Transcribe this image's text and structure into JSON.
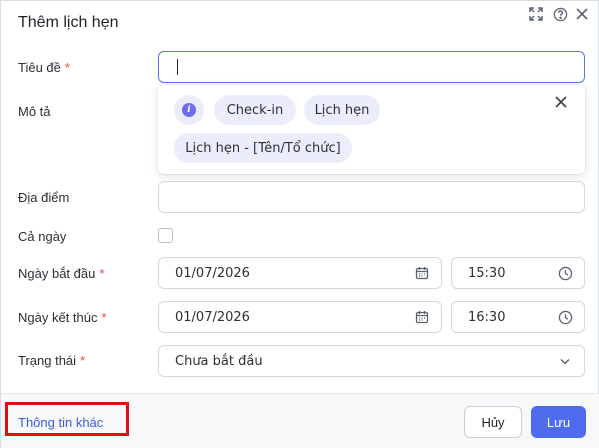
{
  "dialog": {
    "title": "Thêm lịch hẹn",
    "header_icons": [
      "expand-icon",
      "help-icon",
      "close-icon"
    ]
  },
  "form": {
    "title_field": {
      "label": "Tiêu đề",
      "required": "*",
      "value": ""
    },
    "description": {
      "label": "Mô tả"
    },
    "location": {
      "label": "Địa điểm",
      "value": ""
    },
    "all_day": {
      "label": "Cả ngày",
      "checked": false
    },
    "start": {
      "label": "Ngày bắt đầu",
      "required": "*",
      "date": "01/07/2026",
      "time": "15:30"
    },
    "end": {
      "label": "Ngày kết thúc",
      "required": "*",
      "date": "01/07/2026",
      "time": "16:30"
    },
    "status": {
      "label": "Trạng thái",
      "required": "*",
      "value": "Chưa bắt đầu"
    }
  },
  "suggestions": {
    "chips": [
      "Check-in",
      "Lịch hẹn"
    ],
    "template": "Lịch hẹn - [Tên/Tổ chức]"
  },
  "footer": {
    "more_info": "Thông tin khác",
    "cancel": "Hủy",
    "save": "Lưu"
  },
  "colors": {
    "primary": "#4f6bed",
    "link": "#3b5bdb",
    "required": "#e5484d",
    "chip_bg": "#ecedfa",
    "highlight_box": "#e01010"
  }
}
